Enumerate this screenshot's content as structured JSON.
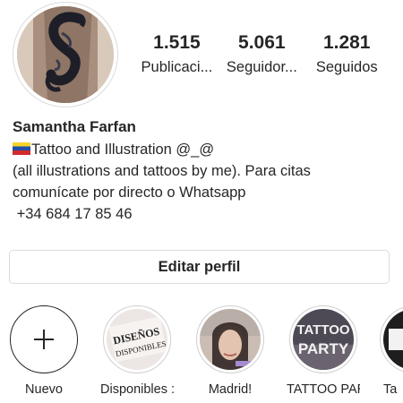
{
  "profile": {
    "name": "Samantha Farfan",
    "bio": [
      "Tattoo and Illustration @_@",
      "(all illustrations and tattoos by me). Para citas",
      "comunícate por directo o Whatsapp",
      " +34 684 17 85 46"
    ],
    "flag_icon": "venezuela-flag"
  },
  "stats": [
    {
      "value": "1.515",
      "label": "Publicaci..."
    },
    {
      "value": "5.061",
      "label": "Seguidor..."
    },
    {
      "value": "1.281",
      "label": "Seguidos"
    }
  ],
  "edit_button": "Editar perfil",
  "highlights": [
    {
      "label": "Nuevo"
    },
    {
      "label": "Disponibles :D",
      "cover_text": "DISEÑOS DISPONIBLES"
    },
    {
      "label": "Madrid!"
    },
    {
      "label": "TATTOO PAR...",
      "cover_text": "TATTOO PARTY"
    },
    {
      "label": "Ta"
    }
  ]
}
